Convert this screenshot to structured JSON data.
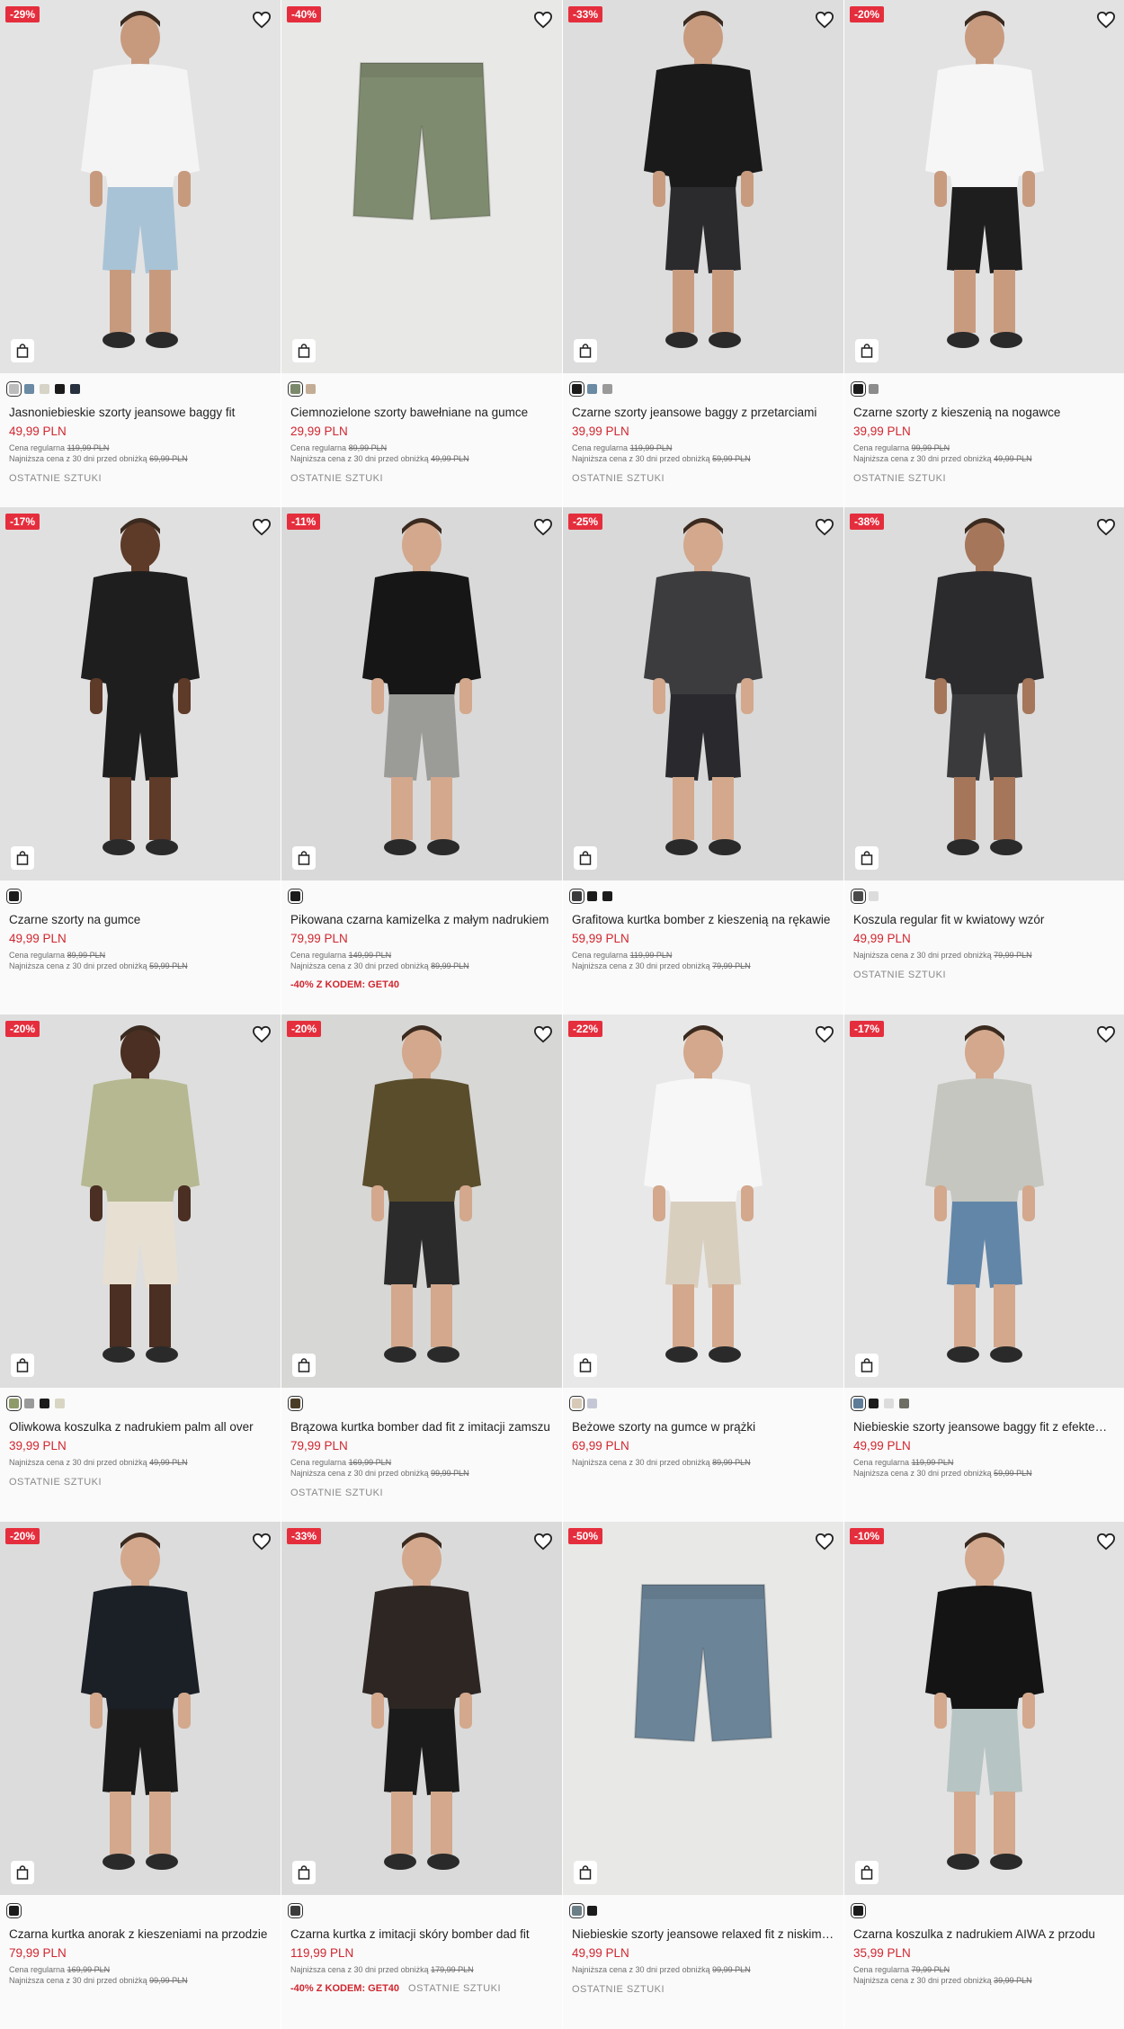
{
  "products": [
    {
      "badge": "-29%",
      "name": "Jasnoniebieskie szorty jeansowe baggy fit",
      "price": "49,99 PLN",
      "regular_label": "Cena regularna",
      "regular_price": "119,99 PLN",
      "lowest_label": "Najniższa cena z 30 dni przed obniżką",
      "lowest_price": "69,99 PLN",
      "promo": "",
      "status": "OSTATNIE SZTUKI",
      "swatches": [
        "#bcbcbc",
        "#6b8aa3",
        "#d6d3c7",
        "#1b1b1b",
        "#26313d"
      ],
      "bg": "#e3e3e3",
      "top": "#f4f4f4",
      "bottom": "#a9c3d6",
      "skin": "#c79a7e"
    },
    {
      "badge": "-40%",
      "name": "Ciemnozielone szorty bawełniane na gumce",
      "price": "29,99 PLN",
      "regular_label": "Cena regularna",
      "regular_price": "89,99 PLN",
      "lowest_label": "Najniższa cena z 30 dni przed obniżką",
      "lowest_price": "49,99 PLN",
      "promo": "",
      "status": "OSTATNIE SZTUKI",
      "swatches": [
        "#7b8a6b",
        "#c4ad96"
      ],
      "bg": "#e8e8e6",
      "top": "",
      "bottom": "#7f8b6f",
      "skin": ""
    },
    {
      "badge": "-33%",
      "name": "Czarne szorty jeansowe baggy z przetarciami",
      "price": "39,99 PLN",
      "regular_label": "Cena regularna",
      "regular_price": "119,99 PLN",
      "lowest_label": "Najniższa cena z 30 dni przed obniżką",
      "lowest_price": "59,99 PLN",
      "promo": "",
      "status": "OSTATNIE SZTUKI",
      "swatches": [
        "#1b1b1b",
        "#6b8aa3",
        "#9a9a9a"
      ],
      "bg": "#dddddd",
      "top": "#1a1a1a",
      "bottom": "#2b2b2e",
      "skin": "#c89b7f"
    },
    {
      "badge": "-20%",
      "name": "Czarne szorty z kieszenią na nogawce",
      "price": "39,99 PLN",
      "regular_label": "Cena regularna",
      "regular_price": "99,99 PLN",
      "lowest_label": "Najniższa cena z 30 dni przed obniżką",
      "lowest_price": "49,99 PLN",
      "promo": "",
      "status": "OSTATNIE SZTUKI",
      "swatches": [
        "#1b1b1b",
        "#8c8c8c"
      ],
      "bg": "#e2e2e2",
      "top": "#f6f6f6",
      "bottom": "#1e1e1e",
      "skin": "#c89b7f"
    },
    {
      "badge": "-17%",
      "name": "Czarne szorty na gumce",
      "price": "49,99 PLN",
      "regular_label": "Cena regularna",
      "regular_price": "89,99 PLN",
      "lowest_label": "Najniższa cena z 30 dni przed obniżką",
      "lowest_price": "59,99 PLN",
      "promo": "",
      "status": "",
      "swatches": [
        "#1b1b1b"
      ],
      "bg": "#e0e0e0",
      "top": "#1e1e1e",
      "bottom": "#1e1e1e",
      "skin": "#5e3a28"
    },
    {
      "badge": "-11%",
      "name": "Pikowana czarna kamizelka z małym nadrukiem",
      "price": "79,99 PLN",
      "regular_label": "Cena regularna",
      "regular_price": "149,99 PLN",
      "lowest_label": "Najniższa cena z 30 dni przed obniżką",
      "lowest_price": "89,99 PLN",
      "promo": "-40% Z KODEM: GET40",
      "status": "",
      "swatches": [
        "#1b1b1b"
      ],
      "bg": "#d9d9d9",
      "top": "#161616",
      "bottom": "#9b9b98",
      "skin": "#d3a88c"
    },
    {
      "badge": "-25%",
      "name": "Grafitowa kurtka bomber z kieszenią na rękawie",
      "price": "59,99 PLN",
      "regular_label": "Cena regularna",
      "regular_price": "119,99 PLN",
      "lowest_label": "Najniższa cena z 30 dni przed obniżką",
      "lowest_price": "79,99 PLN",
      "promo": "",
      "status": "",
      "swatches": [
        "#3a3a3c",
        "#1b1b1b",
        "#1b1b1b"
      ],
      "bg": "#d9d9d9",
      "top": "#3c3c3f",
      "bottom": "#2a2a2e",
      "skin": "#d3a88c"
    },
    {
      "badge": "-38%",
      "name": "Koszula regular fit w kwiatowy wzór",
      "price": "49,99 PLN",
      "regular_label": "",
      "regular_price": "",
      "lowest_label": "Najniższa cena z 30 dni przed obniżką",
      "lowest_price": "79,99 PLN",
      "promo": "",
      "status": "OSTATNIE SZTUKI",
      "swatches": [
        "#4a4a4a",
        "#dcdcdc"
      ],
      "bg": "#dcdcdc",
      "top": "#2b2b2e",
      "bottom": "#3a3a3c",
      "skin": "#a57659"
    },
    {
      "badge": "-20%",
      "name": "Oliwkowa koszulka z nadrukiem palm all over",
      "price": "39,99 PLN",
      "regular_label": "",
      "regular_price": "",
      "lowest_label": "Najniższa cena z 30 dni przed obniżką",
      "lowest_price": "49,99 PLN",
      "promo": "",
      "status": "OSTATNIE SZTUKI",
      "swatches": [
        "#8e9a6a",
        "#9a9a9a",
        "#1b1b1b",
        "#d8d6c2"
      ],
      "bg": "#dedede",
      "top": "#b6b891",
      "bottom": "#e7e0d2",
      "skin": "#4a2f22"
    },
    {
      "badge": "-20%",
      "name": "Brązowa kurtka bomber dad fit z imitacji zamszu",
      "price": "79,99 PLN",
      "regular_label": "Cena regularna",
      "regular_price": "169,99 PLN",
      "lowest_label": "Najniższa cena z 30 dni przed obniżką",
      "lowest_price": "99,99 PLN",
      "promo": "",
      "status": "OSTATNIE SZTUKI",
      "swatches": [
        "#4a3d26"
      ],
      "bg": "#d7d7d5",
      "top": "#5a4d2c",
      "bottom": "#2b2b2b",
      "skin": "#d3a88c"
    },
    {
      "badge": "-22%",
      "name": "Beżowe szorty na gumce w prążki",
      "price": "69,99 PLN",
      "regular_label": "",
      "regular_price": "",
      "lowest_label": "Najniższa cena z 30 dni przed obniżką",
      "lowest_price": "89,99 PLN",
      "promo": "",
      "status": "",
      "swatches": [
        "#d6c9b6",
        "#c5c8d4"
      ],
      "bg": "#e8e8e8",
      "top": "#f7f7f7",
      "bottom": "#d9cfbf",
      "skin": "#d3a88c"
    },
    {
      "badge": "-17%",
      "name": "Niebieskie szorty jeansowe baggy fit z efektem sprania",
      "price": "49,99 PLN",
      "regular_label": "Cena regularna",
      "regular_price": "119,99 PLN",
      "lowest_label": "Najniższa cena z 30 dni przed obniżką",
      "lowest_price": "59,99 PLN",
      "promo": "",
      "status": "",
      "swatches": [
        "#5d7c98",
        "#1b1b1b",
        "#dcdcdc",
        "#6e6e64"
      ],
      "bg": "#e3e3e3",
      "top": "#c5c6bf",
      "bottom": "#6286a8",
      "skin": "#d3a88c"
    },
    {
      "badge": "-20%",
      "name": "Czarna kurtka anorak z kieszeniami na przodzie",
      "price": "79,99 PLN",
      "regular_label": "Cena regularna",
      "regular_price": "169,99 PLN",
      "lowest_label": "Najniższa cena z 30 dni przed obniżką",
      "lowest_price": "99,99 PLN",
      "promo": "",
      "status": "",
      "swatches": [
        "#1b1b1b"
      ],
      "bg": "#dcdcdc",
      "top": "#1b1f26",
      "bottom": "#1b1b1b",
      "skin": "#d3a88c"
    },
    {
      "badge": "-33%",
      "name": "Czarna kurtka z imitacji skóry bomber dad fit",
      "price": "119,99 PLN",
      "regular_label": "",
      "regular_price": "",
      "lowest_label": "Najniższa cena z 30 dni przed obniżką",
      "lowest_price": "179,99 PLN",
      "promo": "-40% Z KODEM: GET40",
      "status": "OSTATNIE SZTUKI",
      "swatches": [
        "#3a3a3a"
      ],
      "bg": "#dadada",
      "top": "#2e2623",
      "bottom": "#1b1b1b",
      "skin": "#d3a88c"
    },
    {
      "badge": "-50%",
      "name": "Niebieskie szorty jeansowe relaxed fit z niskim stanem",
      "price": "49,99 PLN",
      "regular_label": "",
      "regular_price": "",
      "lowest_label": "Najniższa cena z 30 dni przed obniżką",
      "lowest_price": "99,99 PLN",
      "promo": "",
      "status": "OSTATNIE SZTUKI",
      "swatches": [
        "#6d7f86",
        "#1b1b1b"
      ],
      "bg": "#e8e8e6",
      "top": "",
      "bottom": "#6c8498",
      "skin": ""
    },
    {
      "badge": "-10%",
      "name": "Czarna koszulka z nadrukiem AIWA z przodu",
      "price": "35,99 PLN",
      "regular_label": "Cena regularna",
      "regular_price": "79,99 PLN",
      "lowest_label": "Najniższa cena z 30 dni przed obniżką",
      "lowest_price": "39,99 PLN",
      "promo": "",
      "status": "",
      "swatches": [
        "#1b1b1b"
      ],
      "bg": "#e2e2e2",
      "top": "#141414",
      "bottom": "#b6c4c3",
      "skin": "#d3a88c"
    }
  ]
}
